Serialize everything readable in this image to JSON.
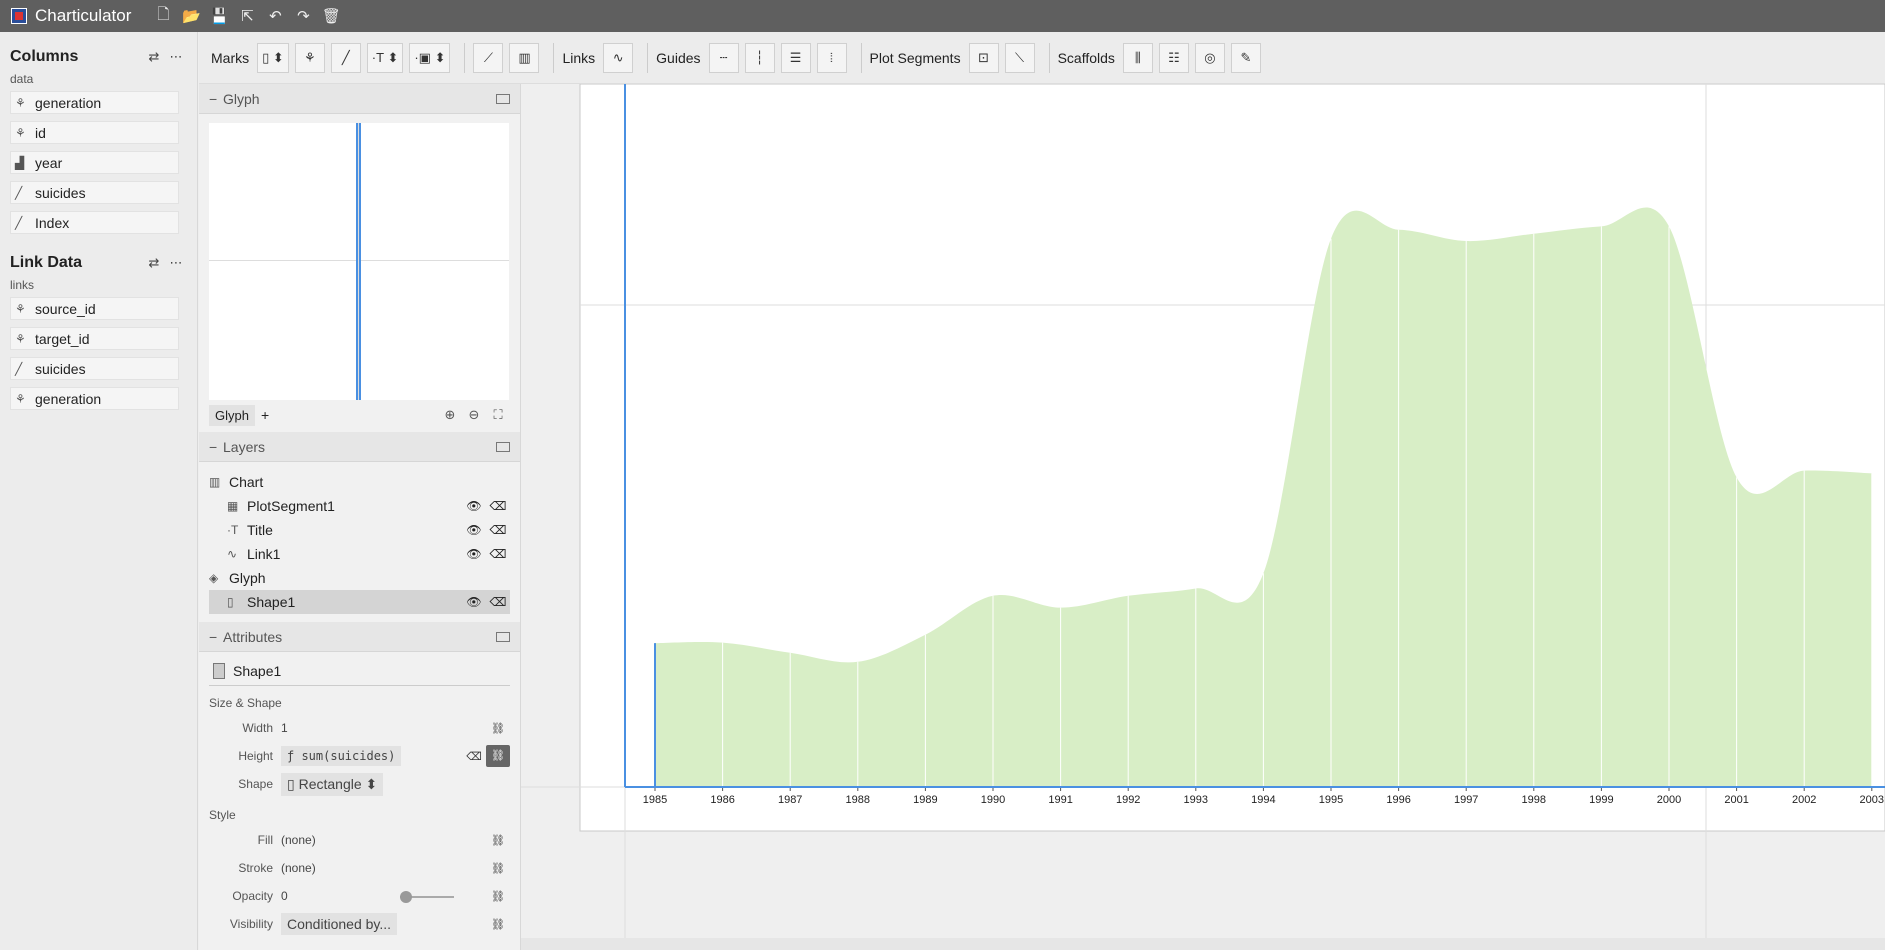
{
  "app": {
    "title": "Charticulator"
  },
  "titlebar_icons": [
    "new-file-icon",
    "open-folder-icon",
    "save-icon",
    "export-icon",
    "undo-icon",
    "redo-icon",
    "delete-icon"
  ],
  "columns": {
    "title": "Columns",
    "table_name": "data",
    "items": [
      {
        "label": "generation",
        "icon": "categorical-icon"
      },
      {
        "label": "id",
        "icon": "categorical-icon"
      },
      {
        "label": "year",
        "icon": "ordinal-icon"
      },
      {
        "label": "suicides",
        "icon": "numerical-icon"
      },
      {
        "label": "Index",
        "icon": "numerical-icon"
      }
    ]
  },
  "links": {
    "title": "Link Data",
    "table_name": "links",
    "items": [
      {
        "label": "source_id",
        "icon": "categorical-icon"
      },
      {
        "label": "target_id",
        "icon": "categorical-icon"
      },
      {
        "label": "suicides",
        "icon": "numerical-icon"
      },
      {
        "label": "generation",
        "icon": "categorical-icon"
      }
    ]
  },
  "glyph_panel": {
    "title": "Glyph",
    "tab_label": "Glyph",
    "add_label": "+"
  },
  "layers_panel": {
    "title": "Layers",
    "items": [
      {
        "label": "Chart",
        "icon": "chart-icon",
        "level": 0,
        "actions": false,
        "selected": false
      },
      {
        "label": "PlotSegment1",
        "icon": "grid-icon",
        "level": 1,
        "actions": true,
        "selected": false
      },
      {
        "label": "Title",
        "icon": "text-icon",
        "level": 1,
        "actions": true,
        "selected": false
      },
      {
        "label": "Link1",
        "icon": "link-icon",
        "level": 1,
        "actions": true,
        "selected": false
      },
      {
        "label": "Glyph",
        "icon": "glyph-icon",
        "level": 0,
        "actions": false,
        "selected": false
      },
      {
        "label": "Shape1",
        "icon": "rect-icon",
        "level": 1,
        "actions": true,
        "selected": true
      }
    ]
  },
  "attributes_panel": {
    "title": "Attributes",
    "object_name": "Shape1",
    "size_shape_label": "Size & Shape",
    "width_label": "Width",
    "width_value": "1",
    "height_label": "Height",
    "height_expr": "ƒ sum(suicides)",
    "shape_label": "Shape",
    "shape_value": "Rectangle",
    "style_label": "Style",
    "fill_label": "Fill",
    "fill_value": "(none)",
    "stroke_label": "Stroke",
    "stroke_value": "(none)",
    "opacity_label": "Opacity",
    "opacity_value": "0",
    "visibility_label": "Visibility",
    "visibility_value": "Conditioned by..."
  },
  "toolbar": {
    "marks_label": "Marks",
    "links_label": "Links",
    "guides_label": "Guides",
    "plot_segments_label": "Plot Segments",
    "scaffolds_label": "Scaffolds"
  },
  "colors": {
    "area_fill": "#d8eec6",
    "accent": "#4a90e2",
    "titlebar": "#5f5f5f"
  },
  "chart_data": {
    "type": "area",
    "x": [
      1985,
      1986,
      1987,
      1988,
      1989,
      1990,
      1991,
      1992,
      1993,
      1994,
      1995,
      1996,
      1997,
      1998,
      1999,
      2000,
      2001,
      2002,
      2003
    ],
    "x_tick_labels": [
      "1985",
      "1986",
      "1987",
      "1988",
      "1989",
      "1990",
      "1991",
      "1992",
      "1993",
      "1994",
      "1995",
      "1996",
      "1997",
      "1998",
      "1999",
      "2000",
      "2001",
      "2002",
      "2003"
    ],
    "values": [
      0.255,
      0.256,
      0.238,
      0.222,
      0.27,
      0.339,
      0.318,
      0.339,
      0.352,
      0.379,
      0.972,
      0.988,
      0.968,
      0.981,
      0.994,
      0.994,
      0.549,
      0.561,
      0.556
    ],
    "ylim": [
      0,
      1
    ],
    "grid": true
  }
}
